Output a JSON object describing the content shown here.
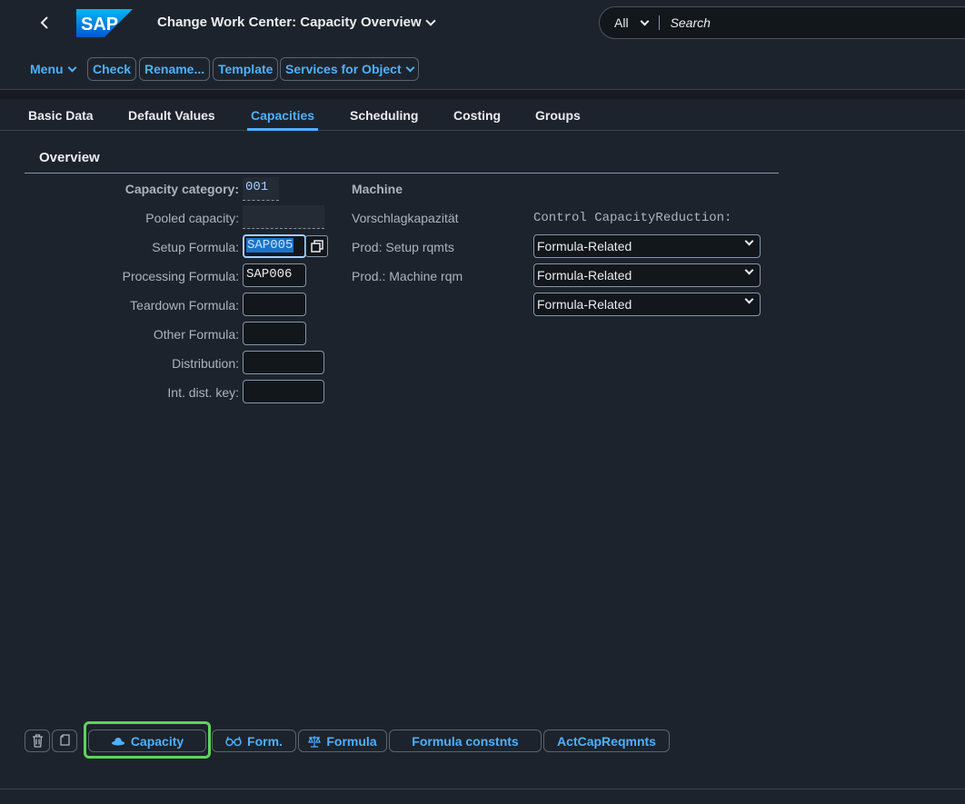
{
  "header": {
    "title": "Change Work Center: Capacity Overview",
    "logo_text": "SAP",
    "search": {
      "scope": "All",
      "placeholder": "Search"
    }
  },
  "toolbar": {
    "menu_label": "Menu",
    "check_label": "Check",
    "rename_label": "Rename...",
    "template_label": "Template",
    "services_label": "Services for Object"
  },
  "tabs": [
    {
      "label": "Basic Data",
      "active": false
    },
    {
      "label": "Default Values",
      "active": false
    },
    {
      "label": "Capacities",
      "active": true
    },
    {
      "label": "Scheduling",
      "active": false
    },
    {
      "label": "Costing",
      "active": false
    },
    {
      "label": "Groups",
      "active": false
    }
  ],
  "overview": {
    "title": "Overview",
    "fields": {
      "capacity_category": {
        "label": "Capacity category:",
        "value": "001",
        "description": "Machine"
      },
      "pooled_capacity": {
        "label": "Pooled capacity:",
        "value": "",
        "description": "Vorschlagkapazität"
      },
      "setup_formula": {
        "label": "Setup Formula:",
        "value": "SAP005",
        "description": "Prod: Setup rqmts"
      },
      "processing_formula": {
        "label": "Processing Formula:",
        "value": "SAP006",
        "description": "Prod.: Machine rqm"
      },
      "teardown_formula": {
        "label": "Teardown Formula:",
        "value": ""
      },
      "other_formula": {
        "label": "Other Formula:",
        "value": ""
      },
      "distribution": {
        "label": "Distribution:",
        "value": ""
      },
      "int_dist_key": {
        "label": "Int. dist. key:",
        "value": ""
      }
    },
    "control_header": "Control CapacityReduction:",
    "control_selects": [
      "Formula-Related",
      "Formula-Related",
      "Formula-Related"
    ]
  },
  "footer": {
    "capacity_label": "Capacity",
    "form_label": "Form.",
    "formula_label": "Formula",
    "formula_constnts_label": "Formula constnts",
    "actcap_label": "ActCapReqmnts"
  },
  "colors": {
    "accent": "#4db1ff",
    "background": "#1d232c",
    "highlight": "#5fd35c"
  }
}
